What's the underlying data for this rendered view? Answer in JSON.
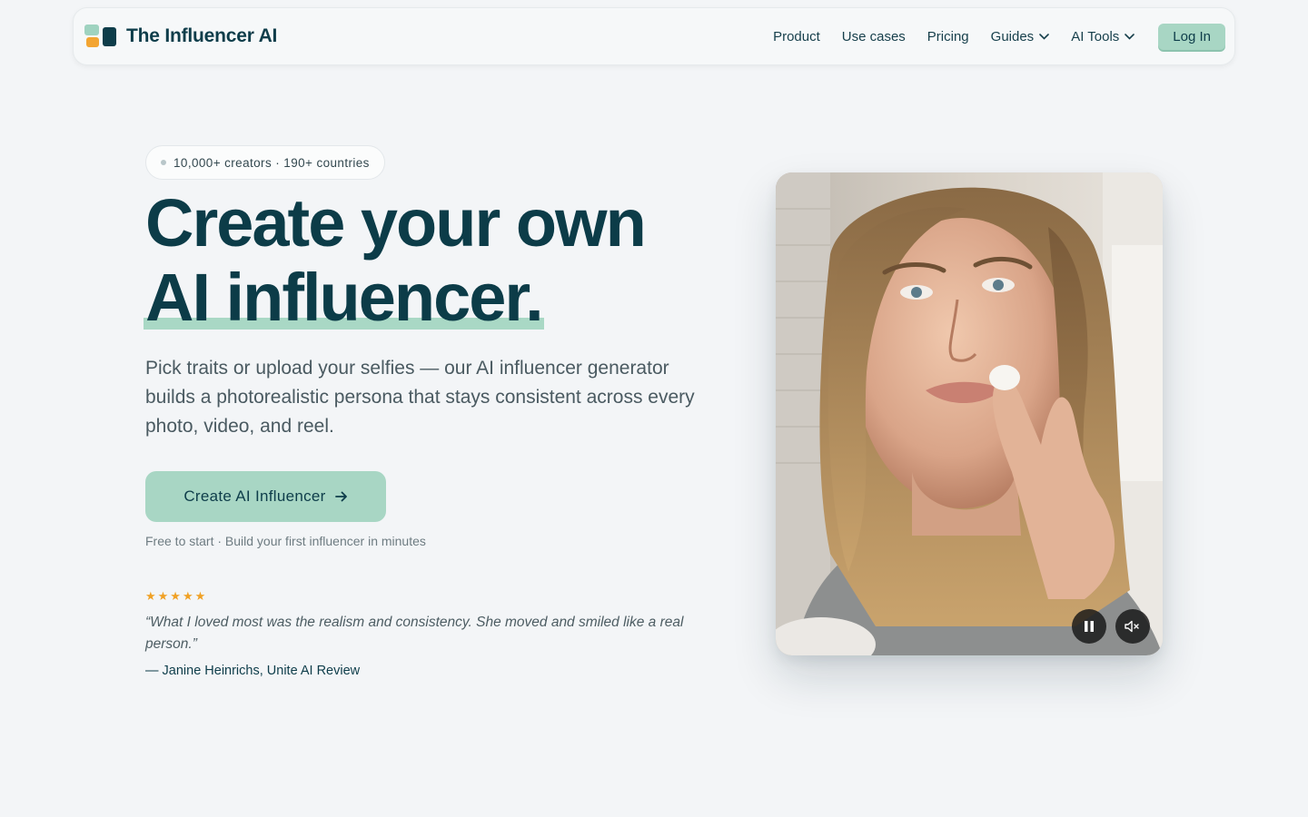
{
  "nav": {
    "brand": "The Influencer AI",
    "links": [
      {
        "label": "Product"
      },
      {
        "label": "Use cases"
      },
      {
        "label": "Pricing"
      },
      {
        "label": "Guides",
        "dropdown": true
      },
      {
        "label": "AI Tools",
        "dropdown": true
      }
    ],
    "login": "Log In"
  },
  "hero": {
    "badge": "10,000+ creators · 190+ countries",
    "title_line1": "Create your own",
    "title_line2": "AI influencer.",
    "lead": "Pick traits or upload your selfies — our AI influencer generator builds a photorealistic persona that stays consistent across every photo, video, and reel.",
    "cta": "Create AI Influencer",
    "cta_icon": "arrow-right-icon",
    "note": "Free to start · Build your first influencer in minutes",
    "rating": "★★★★★",
    "quote": "“What I loved most was the realism and consistency. She moved and smiled like a real person.”",
    "author": "— Janine Heinrichs, Unite AI Review"
  },
  "video": {
    "controls": [
      "pause-icon",
      "mute-icon"
    ]
  },
  "colors": {
    "background": "#f3f5f7",
    "primary_dark": "#0c3c48",
    "accent_mint": "#a8d6c4",
    "star": "#f0a125",
    "logo_orange": "#f3a532"
  }
}
